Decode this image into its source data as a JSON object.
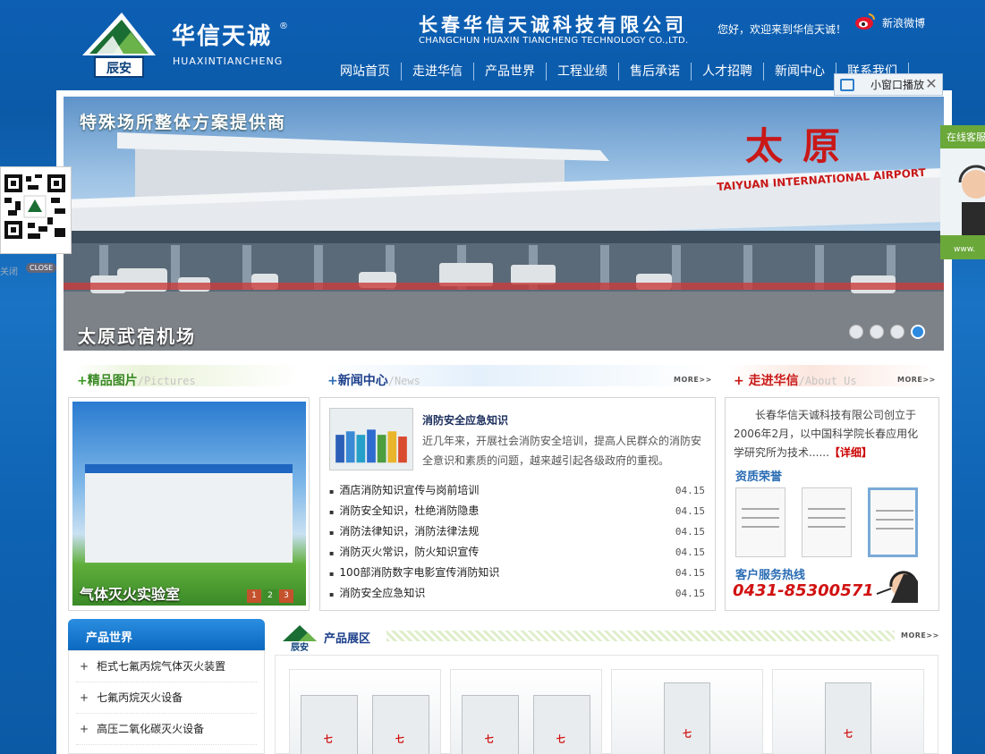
{
  "header": {
    "logo_cn": "华信天诚",
    "logo_reg": "®",
    "logo_en": "HUAXINTIANCHENG",
    "logo_badge": "辰安",
    "company_cn": "长春华信天诚科技有限公司",
    "company_en": "CHANGCHUN HUAXIN TIANCHENG TECHNOLOGY CO.,LTD.",
    "welcome": "您好，欢迎来到华信天诚！",
    "weibo": "新浪微博",
    "nav": [
      "网站首页",
      "走进华信",
      "产品世界",
      "工程业绩",
      "售后承诺",
      "人才招聘",
      "新闻中心",
      "联系我们"
    ]
  },
  "float_player": {
    "label": "小窗口播放",
    "close": "✕"
  },
  "qr": {
    "badge": "辰安",
    "close_label": "关闭",
    "close_btn": "CLOSE"
  },
  "kefu": {
    "label": "在线客服",
    "bottom": "www."
  },
  "banner": {
    "slogan": "特殊场所整体方案提供商",
    "caption": "太原武宿机场",
    "sign_cn": "太原",
    "sign_en": "TAIYUAN INTERNATIONAL AIRPORT",
    "dots": 4,
    "active_dot": 4
  },
  "pictures": {
    "title_plus": "+",
    "title_cn": "精品图片",
    "title_en": "/Pictures",
    "caption": "气体灭火实验室",
    "nums": [
      "1",
      "2",
      "3"
    ]
  },
  "news": {
    "title_plus": "+",
    "title_cn": "新闻中心",
    "title_en": "/News",
    "more": "MORE>>",
    "headline": "消防安全应急知识",
    "summary": "近几年来，开展社会消防安全培训，提高人民群众的消防安全意识和素质的问题，越来越引起各级政府的重视。",
    "items": [
      {
        "title": "酒店消防知识宣传与岗前培训",
        "date": "04.15"
      },
      {
        "title": "消防安全知识，杜绝消防隐患",
        "date": "04.15"
      },
      {
        "title": "消防法律知识，消防法律法规",
        "date": "04.15"
      },
      {
        "title": "消防灭火常识，防火知识宣传",
        "date": "04.15"
      },
      {
        "title": "100部消防数字电影宣传消防知识",
        "date": "04.15"
      },
      {
        "title": "消防安全应急知识",
        "date": "04.15"
      }
    ]
  },
  "about": {
    "title_plus": "+",
    "title_cn": "走进华信",
    "title_en": "/About Us",
    "more": "MORE>>",
    "text": "长春华信天诚科技有限公司创立于2006年2月，以中国科学院长春应用化学研究所为技术......",
    "detail": "【详细】",
    "honors": "资质荣誉",
    "hotline_label": "客户服务热线",
    "hotline": "0431-85300571"
  },
  "products": {
    "menu_title": "产品世界",
    "menu": [
      "柜式七氟丙烷气体灭火装置",
      "七氟丙烷灭火设备",
      "高压二氧化碳灭火设备"
    ],
    "showroom_title": "产品展区",
    "showroom_badge": "辰安",
    "more": "MORE>>"
  }
}
